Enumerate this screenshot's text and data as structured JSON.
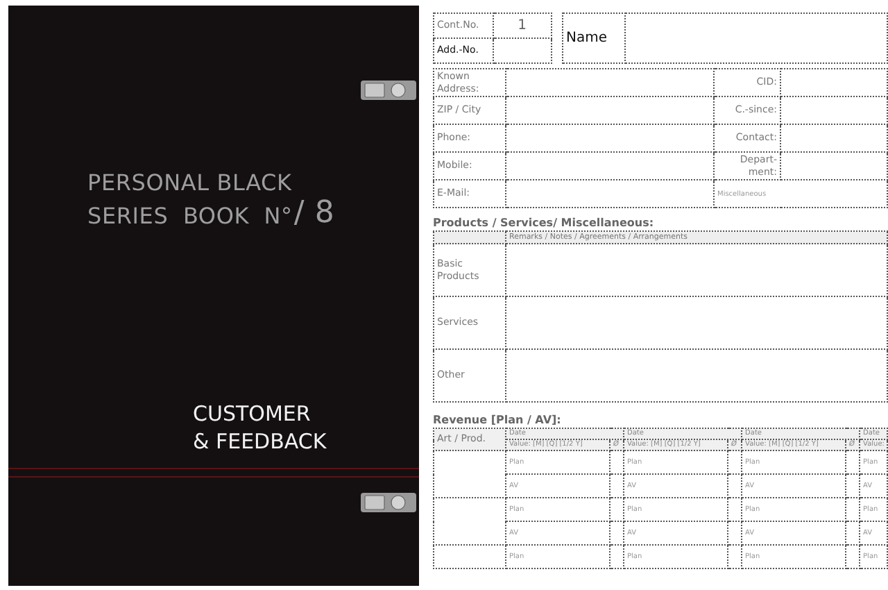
{
  "cover": {
    "title_lines": [
      "PERSONAL BLACK",
      "SERIES  BOOK  N°"
    ],
    "number": "/ 8",
    "subtitle_lines": [
      "CUSTOMER",
      "& FEEDBACK"
    ]
  },
  "form": {
    "header": {
      "cont_no_label": "Cont.No.",
      "cont_no_value": "1",
      "add_no_label": "Add.-No.",
      "name_label": "Name"
    },
    "contact_rows": [
      {
        "label": "Known Address:",
        "right_label": "CID:"
      },
      {
        "label": "ZIP / City",
        "right_label": "C.-since:"
      },
      {
        "label": "Phone:",
        "right_label": "Contact:"
      },
      {
        "label": "Mobile:",
        "right_label": "Depart-ment:"
      },
      {
        "label": "E-Mail:",
        "right_label": "Miscellaneous"
      }
    ],
    "products": {
      "title": "Products / Services/ Miscellaneous:",
      "remarks_header": "Remarks / Notes / Agreements / Arrangements",
      "rows": [
        "Basic Products",
        "Services",
        "Other"
      ]
    },
    "revenue": {
      "title": "Revenue [Plan / AV]:",
      "art_label": "Art / Prod.",
      "columns": [
        {
          "date": "Date",
          "value_header": "Value:  [M]  [Q]  [1/2 Y]",
          "avg": "Ø"
        },
        {
          "date": "Date",
          "value_header": "Value:  [M]  [Q]  [1/2 Y]",
          "avg": "Ø"
        },
        {
          "date": "Date",
          "value_header": "Value:  [M]  [Q]  [1/2 Y]",
          "avg": "Ø"
        },
        {
          "date": "Date",
          "value_header": "Value:"
        }
      ],
      "groups": [
        {
          "rows": [
            [
              "Plan",
              "Plan",
              "Plan",
              "Plan"
            ],
            [
              "AV",
              "AV",
              "AV",
              "AV"
            ]
          ]
        },
        {
          "rows": [
            [
              "Plan",
              "Plan",
              "Plan",
              "Plan"
            ],
            [
              "AV",
              "AV",
              "AV",
              "AV"
            ]
          ]
        },
        {
          "rows": [
            [
              "Plan",
              "Plan",
              "Plan",
              "Plan"
            ]
          ]
        }
      ]
    }
  }
}
